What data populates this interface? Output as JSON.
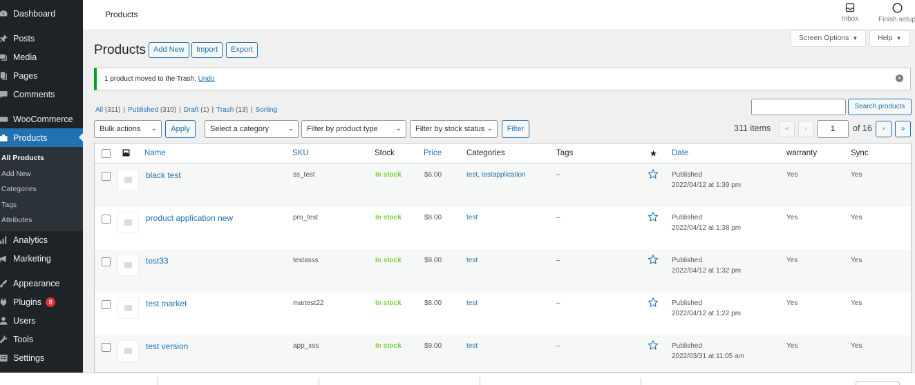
{
  "sidebar": {
    "items": [
      {
        "label": "Dashboard",
        "icon": "dashboard-icon"
      },
      {
        "label": "Posts",
        "icon": "pin-icon"
      },
      {
        "label": "Media",
        "icon": "media-icon"
      },
      {
        "label": "Pages",
        "icon": "pages-icon"
      },
      {
        "label": "Comments",
        "icon": "comment-icon"
      },
      {
        "label": "WooCommerce",
        "icon": "woo-icon"
      },
      {
        "label": "Products",
        "icon": "products-icon"
      },
      {
        "label": "Analytics",
        "icon": "analytics-icon"
      },
      {
        "label": "Marketing",
        "icon": "megaphone-icon"
      },
      {
        "label": "Appearance",
        "icon": "brush-icon"
      },
      {
        "label": "Plugins",
        "icon": "plugin-icon",
        "badge": "8"
      },
      {
        "label": "Users",
        "icon": "users-icon"
      },
      {
        "label": "Tools",
        "icon": "wrench-icon"
      },
      {
        "label": "Settings",
        "icon": "settings-icon"
      }
    ],
    "submenu": [
      "All Products",
      "Add New",
      "Categories",
      "Tags",
      "Attributes"
    ]
  },
  "header": {
    "page_name": "Products",
    "inbox_label": "Inbox",
    "finish_setup_label": "Finish setup",
    "screen_options_label": "Screen Options",
    "help_label": "Help"
  },
  "page": {
    "title": "Products",
    "add_new": "Add New",
    "import": "Import",
    "export": "Export"
  },
  "notice": {
    "message": "1 product moved to the Trash.",
    "undo": "Undo"
  },
  "views": [
    {
      "label": "All",
      "count": "(311)"
    },
    {
      "label": "Published",
      "count": "(310)"
    },
    {
      "label": "Draft",
      "count": "(1)"
    },
    {
      "label": "Trash",
      "count": "(13)"
    },
    {
      "label": "Sorting",
      "count": ""
    }
  ],
  "search": {
    "value": "",
    "button": "Search products"
  },
  "filters": {
    "bulk_actions": "Bulk actions",
    "apply": "Apply",
    "category": "Select a category",
    "product_type": "Filter by product type",
    "stock_status": "Filter by stock status",
    "filter": "Filter"
  },
  "pagination": {
    "items": "311 items",
    "first": "«",
    "prev": "‹",
    "current": "1",
    "of": "of 16",
    "next": "›",
    "last": "»"
  },
  "table": {
    "columns": [
      "Name",
      "SKU",
      "Stock",
      "Price",
      "Categories",
      "Tags",
      "Date",
      "warranty",
      "Sync"
    ],
    "rows": [
      {
        "name": "black test",
        "sku": "ss_test",
        "stock": "In stock",
        "price": "$6.00",
        "categories": "test, testapplication",
        "tags": "–",
        "status": "Published",
        "date": "2022/04/12 at 1:39 pm",
        "warranty": "Yes",
        "sync": "Yes"
      },
      {
        "name": "product application new",
        "sku": "pro_test",
        "stock": "In stock",
        "price": "$8.00",
        "categories": "test",
        "tags": "–",
        "status": "Published",
        "date": "2022/04/12 at 1:38 pm",
        "warranty": "Yes",
        "sync": "Yes"
      },
      {
        "name": "test33",
        "sku": "testasss",
        "stock": "In stock",
        "price": "$9.00",
        "categories": "test",
        "tags": "–",
        "status": "Published",
        "date": "2022/04/12 at 1:32 pm",
        "warranty": "Yes",
        "sync": "Yes"
      },
      {
        "name": "test market",
        "sku": "martest22",
        "stock": "In stock",
        "price": "$8.00",
        "categories": "test",
        "tags": "–",
        "status": "Published",
        "date": "2022/04/12 at 1:22 pm",
        "warranty": "Yes",
        "sync": "Yes"
      },
      {
        "name": "test version",
        "sku": "app_xss",
        "stock": "In stock",
        "price": "$9.00",
        "categories": "test",
        "tags": "–",
        "status": "Published",
        "date": "2022/03/31 at 11:05 am",
        "warranty": "Yes",
        "sync": "Yes"
      }
    ]
  },
  "colors": {
    "accent": "#2271b1",
    "sidebar_bg": "#1d2327",
    "in_stock": "#7ad03a",
    "notice_success": "#00a32a"
  }
}
